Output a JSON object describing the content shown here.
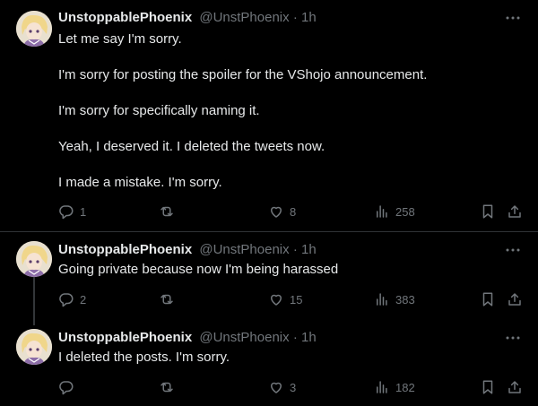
{
  "tweets": [
    {
      "name": "UnstoppablePhoenix",
      "handle": "@UnstPhoenix",
      "sep": "·",
      "time": "1h",
      "paragraphs": [
        "Let me say I'm sorry.",
        "I'm sorry for posting the spoiler for the VShojo announcement.",
        "I'm sorry for specifically naming it.",
        "Yeah, I deserved it. I deleted the tweets now.",
        "I made a mistake. I'm sorry."
      ],
      "replies": "1",
      "reposts": "",
      "likes": "8",
      "views": "258"
    },
    {
      "name": "UnstoppablePhoenix",
      "handle": "@UnstPhoenix",
      "sep": "·",
      "time": "1h",
      "paragraphs": [
        "Going private because now I'm being harassed"
      ],
      "replies": "2",
      "reposts": "",
      "likes": "15",
      "views": "383"
    },
    {
      "name": "UnstoppablePhoenix",
      "handle": "@UnstPhoenix",
      "sep": "·",
      "time": "1h",
      "paragraphs": [
        "I deleted the posts. I'm sorry."
      ],
      "replies": "",
      "reposts": "",
      "likes": "3",
      "views": "182"
    }
  ],
  "icons": {
    "reply": "reply-icon",
    "repost": "repost-icon",
    "like": "like-icon",
    "views": "views-icon",
    "bookmark": "bookmark-icon",
    "share": "share-icon",
    "more": "more-icon"
  },
  "colors": {
    "background": "#000000",
    "text": "#e7e9ea",
    "muted": "#71767b",
    "divider": "#2f3336"
  }
}
